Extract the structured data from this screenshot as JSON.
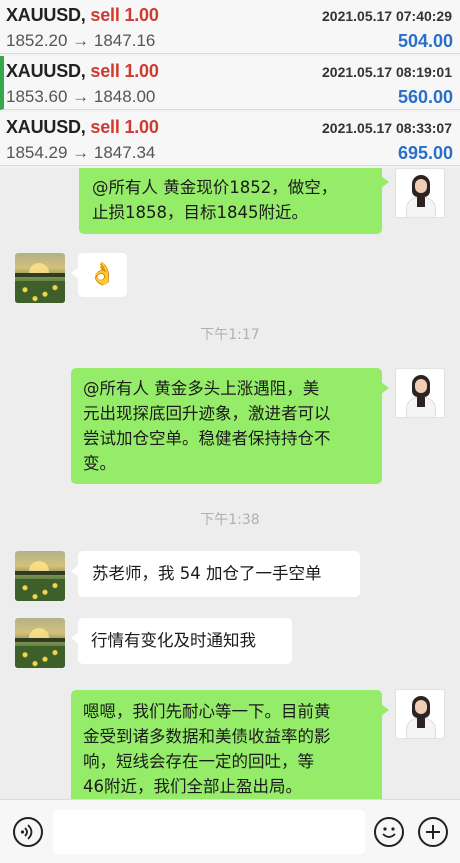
{
  "trades": [
    {
      "symbol": "XAUUSD,",
      "side": "sell 1.00",
      "time": "2021.05.17 07:40:29",
      "price": "1852.20 → 1847.16",
      "profit": "504.00"
    },
    {
      "symbol": "XAUUSD,",
      "side": "sell 1.00",
      "time": "2021.05.17 08:19:01",
      "price": "1853.60 → 1848.00",
      "profit": "560.00"
    },
    {
      "symbol": "XAUUSD,",
      "side": "sell 1.00",
      "time": "2021.05.17 08:33:07",
      "price": "1854.29 → 1847.34",
      "profit": "695.00"
    }
  ],
  "chat": {
    "m1": {
      "lines": [
        "@所有人 黄金现价1852，做空，",
        "止损1858，目标1845附近。"
      ]
    },
    "m2": {
      "emoji": "👌"
    },
    "ts1": "下午1:17",
    "m3": {
      "lines": [
        "@所有人 黄金多头上涨遇阻，美",
        "元出现探底回升迹象，激进者可以",
        "尝试加仓空单。稳健者保持持仓不",
        "变。"
      ]
    },
    "ts2": "下午1:38",
    "m4": {
      "text": "苏老师，我 54 加仓了一手空单"
    },
    "m5": {
      "text": "行情有变化及时通知我"
    },
    "m6": {
      "lines": [
        "嗯嗯，我们先耐心等一下。目前黄",
        "金受到诸多数据和美债收益率的影",
        "响，短线会存在一定的回吐，等",
        "46附近，我们全部止盈出局。"
      ]
    }
  },
  "inputbar": {
    "voice_icon": "voice-icon",
    "emoji_icon": "emoji-icon",
    "plus_icon": "plus-icon",
    "input_value": ""
  }
}
